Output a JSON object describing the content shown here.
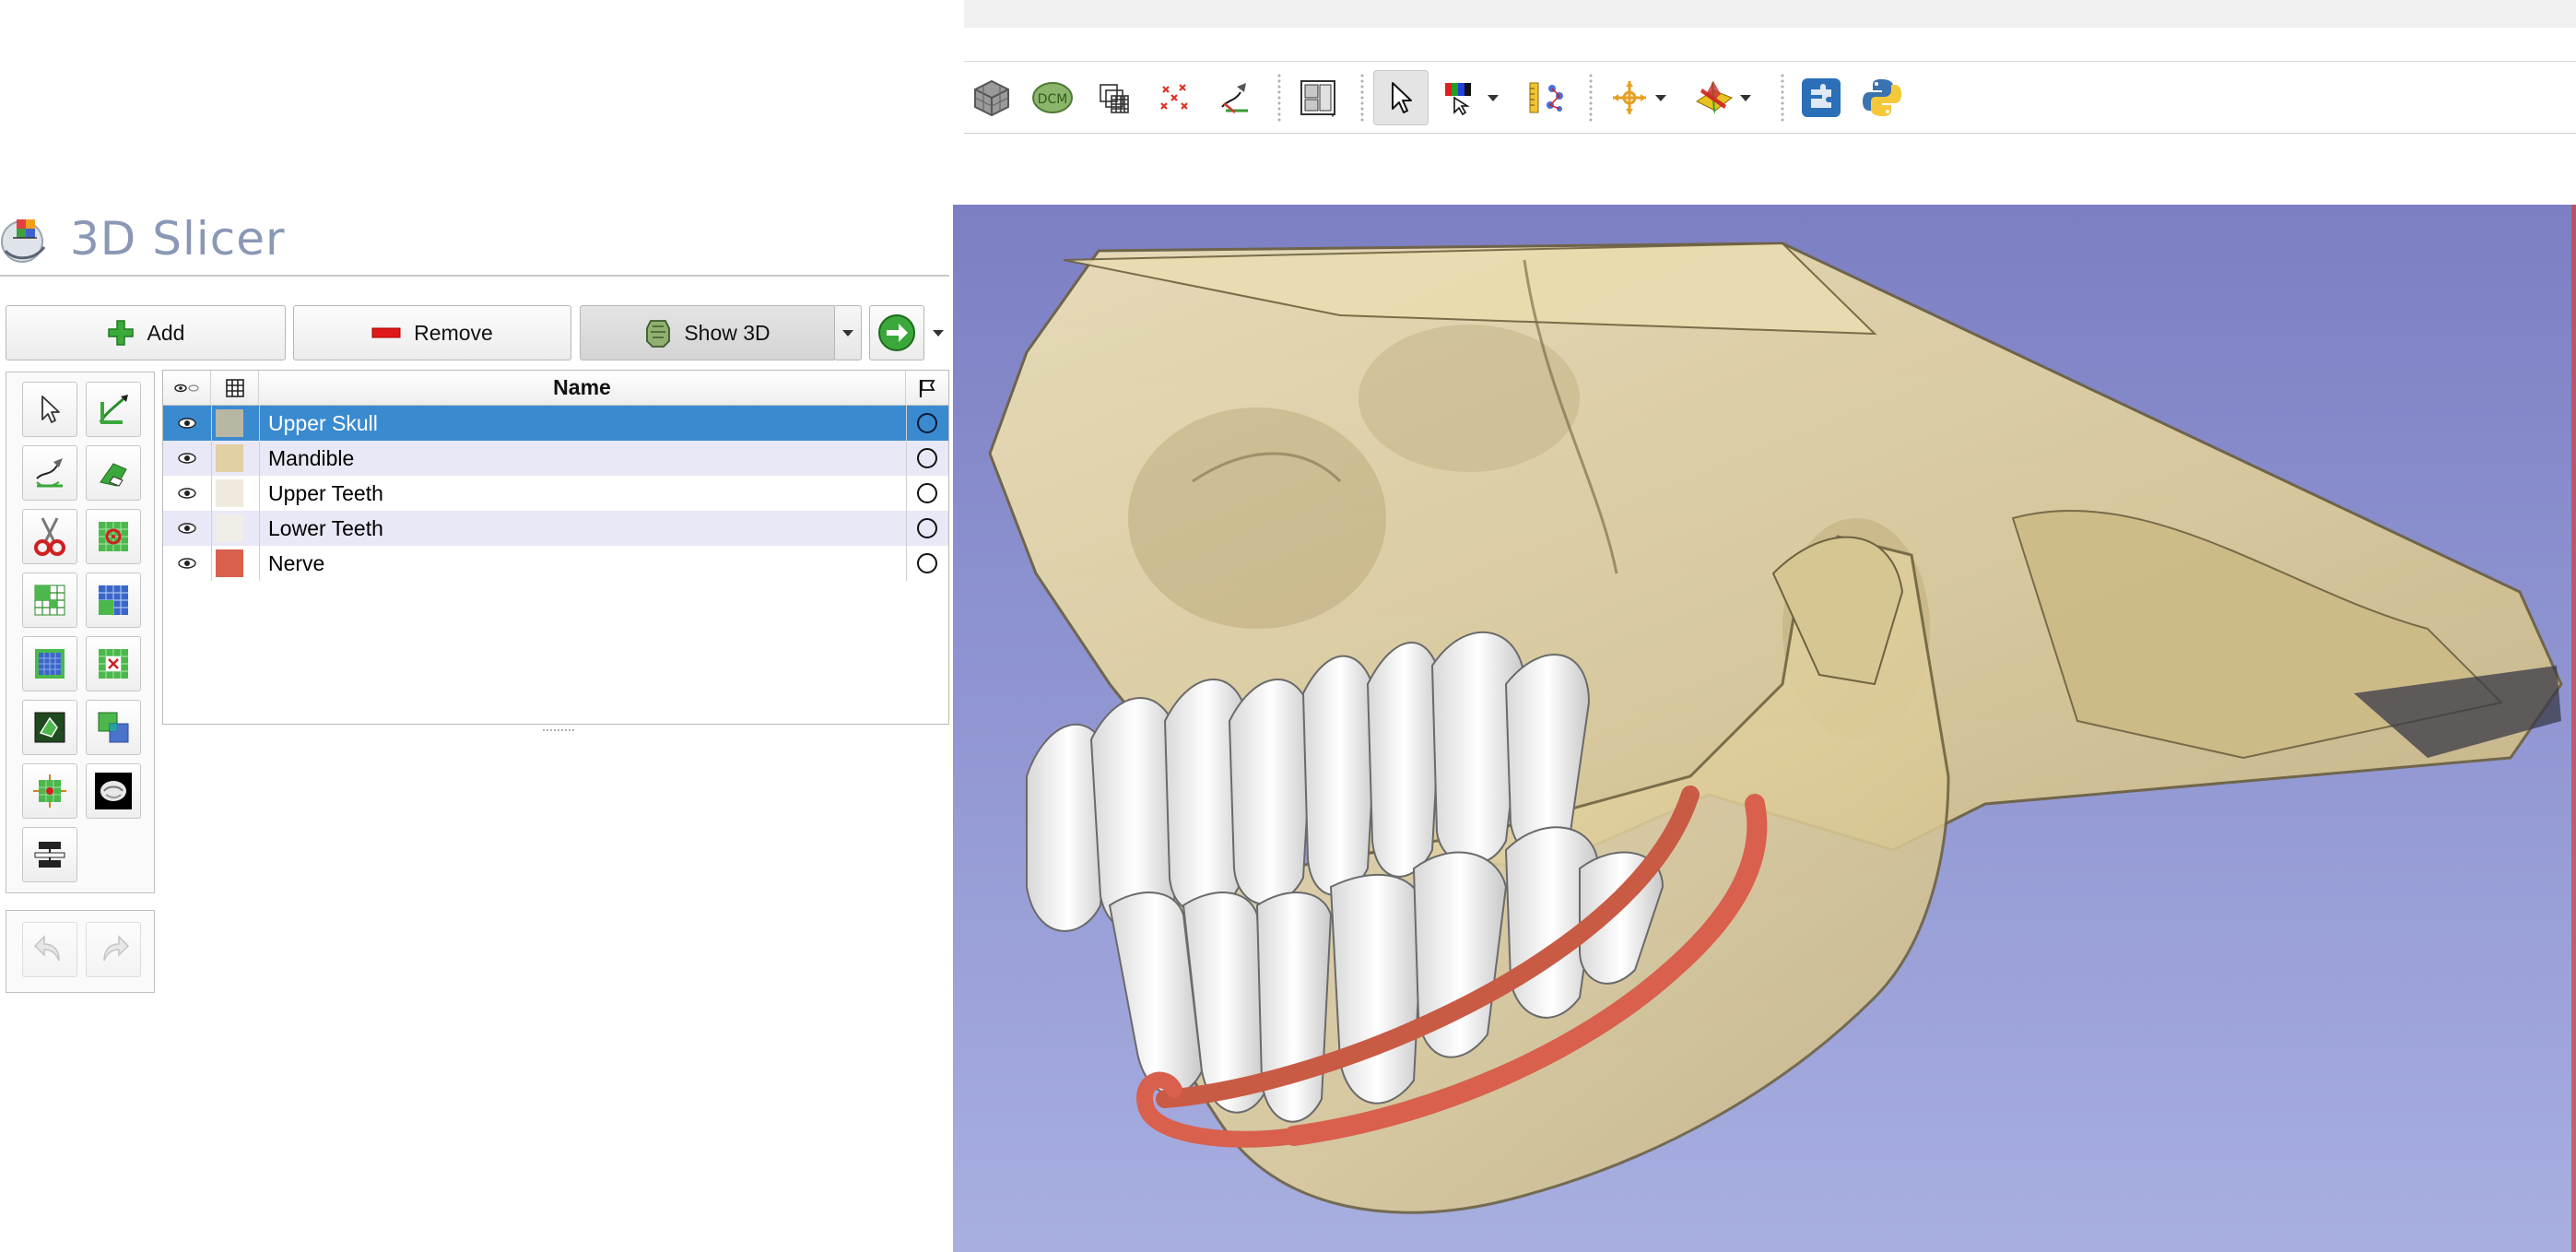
{
  "app": {
    "title": "3D Slicer"
  },
  "toolbar": {
    "tools": [
      {
        "icon": "data-cube-icon"
      },
      {
        "icon": "dcm-icon"
      },
      {
        "icon": "volumes-icon"
      },
      {
        "icon": "models-icon"
      },
      {
        "icon": "segment-editor-icon"
      },
      {
        "icon": "layout-icon"
      },
      {
        "icon": "mouse-pointer-icon",
        "active": true
      },
      {
        "icon": "window-level-icon"
      },
      {
        "icon": "ruler-icon"
      },
      {
        "icon": "crosshair-icon"
      },
      {
        "icon": "slice-intersection-icon"
      },
      {
        "icon": "extensions-icon"
      },
      {
        "icon": "python-icon"
      }
    ]
  },
  "buttons": {
    "add_label": "Add",
    "remove_label": "Remove",
    "show3d_label": "Show 3D"
  },
  "table": {
    "columns": [
      "Name"
    ],
    "rows": [
      {
        "name": "Upper Skull",
        "color": "#b8b6a4",
        "selected": true
      },
      {
        "name": "Mandible",
        "color": "#e0d0a3",
        "selected": false
      },
      {
        "name": "Upper Teeth",
        "color": "#efeadd",
        "selected": false
      },
      {
        "name": "Lower Teeth",
        "color": "#f1eee8",
        "selected": false
      },
      {
        "name": "Nerve",
        "color": "#d8604d",
        "selected": false
      }
    ]
  },
  "colors": {
    "selection": "#3a8ad0",
    "alt_row": "#e8e8f7",
    "view_background": "#8d92d0",
    "bone": "#e4d6a8",
    "teeth": "#eeeeee",
    "nerve": "#d8604d"
  }
}
